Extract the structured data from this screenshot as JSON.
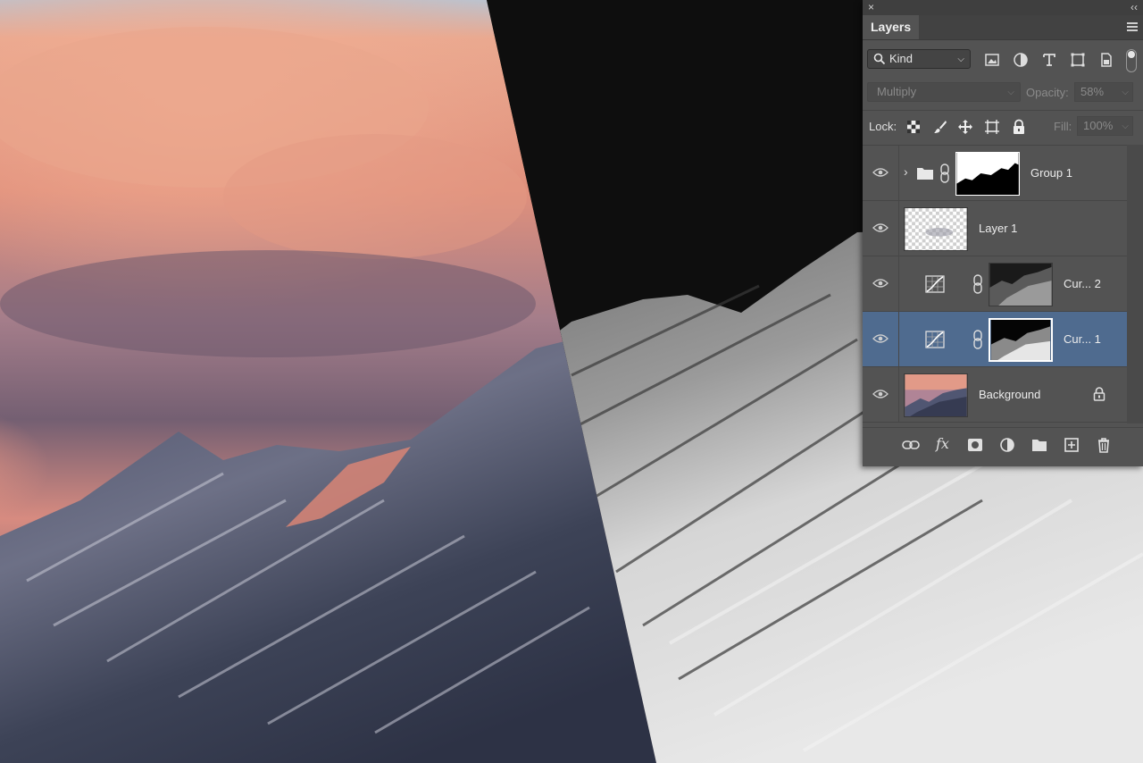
{
  "panel": {
    "tab_title": "Layers",
    "close_glyph": "×",
    "collapse_glyph": "‹‹",
    "filter": {
      "kind_label": "Kind",
      "filter_icons": [
        "image-filter-icon",
        "adjustment-filter-icon",
        "type-filter-icon",
        "shape-filter-icon",
        "smart-object-filter-icon"
      ]
    },
    "blend_mode": "Multiply",
    "opacity_label": "Opacity:",
    "opacity_value": "58%",
    "lock_label": "Lock:",
    "lock_icons": [
      "lock-transparent-pixels-icon",
      "lock-image-pixels-icon",
      "lock-position-icon",
      "lock-artboard-icon",
      "lock-all-icon"
    ],
    "fill_label": "Fill:",
    "fill_value": "100%",
    "layers": [
      {
        "name": "Group 1",
        "type": "group",
        "visible": true,
        "selected": false
      },
      {
        "name": "Layer 1",
        "type": "pixel",
        "visible": true,
        "selected": false
      },
      {
        "name": "Cur... 2",
        "type": "curves",
        "visible": true,
        "selected": false
      },
      {
        "name": "Cur... 1",
        "type": "curves",
        "visible": true,
        "selected": true
      },
      {
        "name": "Background",
        "type": "background",
        "visible": true,
        "selected": false,
        "locked": true
      }
    ],
    "bottom_icons": [
      "link-layers-icon",
      "fx-icon",
      "add-mask-icon",
      "adjustment-layer-icon",
      "new-group-icon",
      "new-layer-icon",
      "delete-layer-icon"
    ],
    "fx_label": "fx"
  },
  "colors": {
    "panel_bg": "#535353",
    "selected_row": "#4f6b8f",
    "sky_pink": "#e79a84",
    "mountain_blue": "#3c4258"
  }
}
